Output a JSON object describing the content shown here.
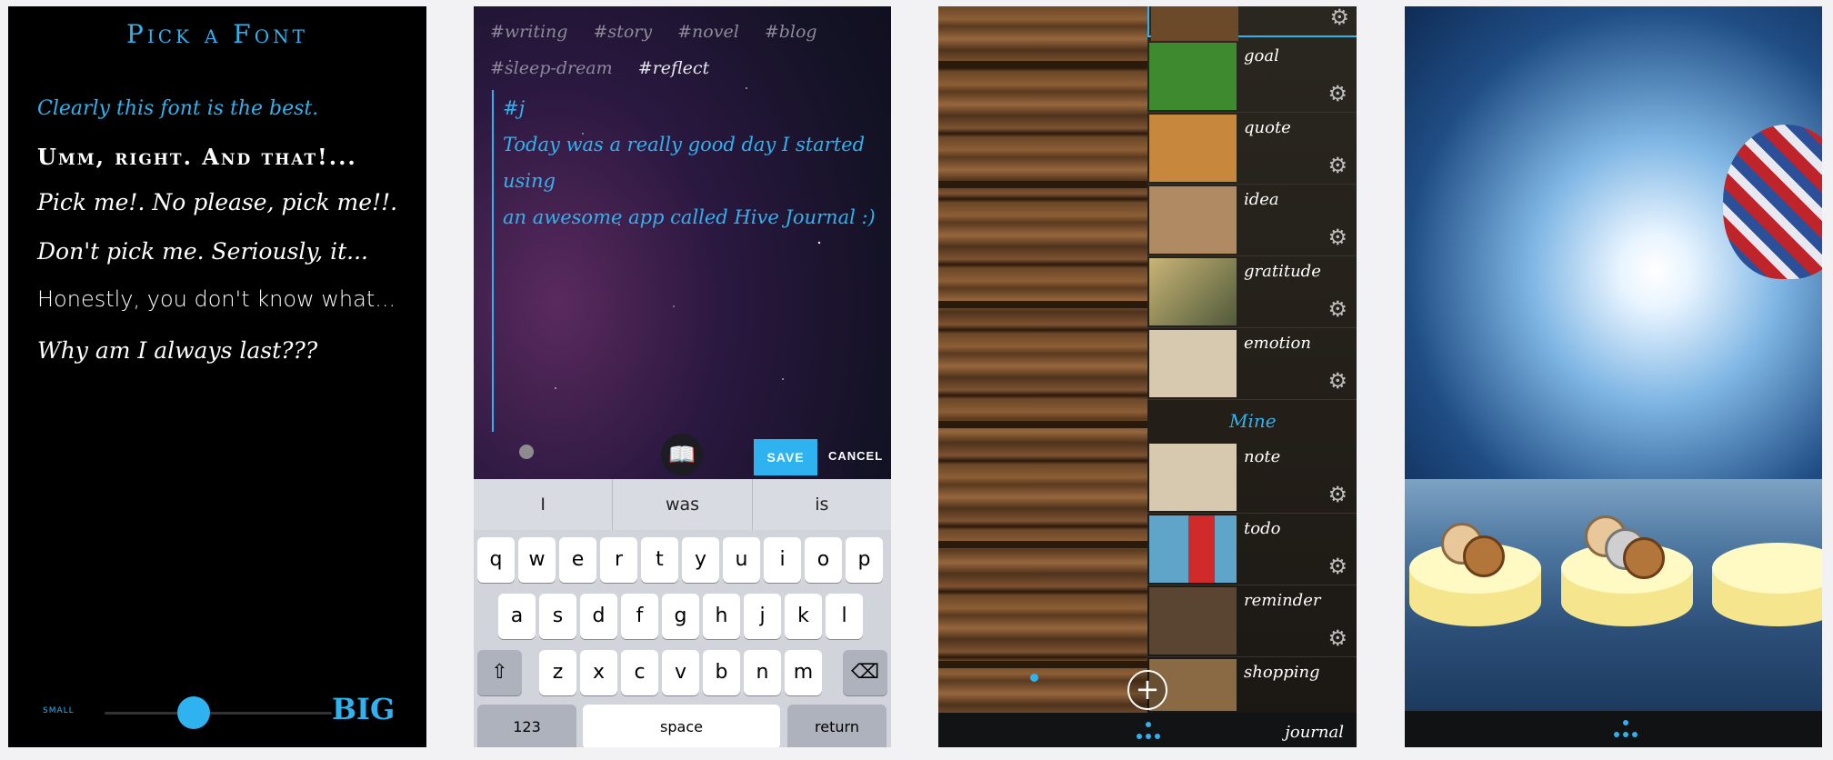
{
  "font_screen": {
    "title": "Pick a Font",
    "samples": [
      "Clearly this font is the best.",
      "Umm, right. And that!...",
      "Pick me!. No please, pick me!!.",
      "Don't pick me. Seriously, it...",
      "Honestly, you don't know what...",
      "Why am I always last???"
    ],
    "slider": {
      "small_label": "small",
      "big_label": "BIG",
      "value_fraction": 0.3
    }
  },
  "editor_screen": {
    "tags": [
      "#writing",
      "#story",
      "#novel",
      "#blog",
      "#sleep-dream",
      "#reflect"
    ],
    "text_line1": "#j",
    "text_line2": "Today was a really good day I started using",
    "text_line3": "an awesome app called Hive Journal :)",
    "save_label": "SAVE",
    "cancel_label": "CANCEL",
    "suggestions": [
      "I",
      "was",
      "is"
    ],
    "keyboard": {
      "row1": [
        "q",
        "w",
        "e",
        "r",
        "t",
        "y",
        "u",
        "i",
        "o",
        "p"
      ],
      "row2": [
        "a",
        "s",
        "d",
        "f",
        "g",
        "h",
        "j",
        "k",
        "l"
      ],
      "row3": [
        "z",
        "x",
        "c",
        "v",
        "b",
        "n",
        "m"
      ],
      "numbers_label": "123",
      "space_label": "space",
      "return_label": "return"
    }
  },
  "journal_list_screen": {
    "items": [
      {
        "label": "goal",
        "thumb_color": "#3e8a2f"
      },
      {
        "label": "quote",
        "thumb_color": "#6b4a2a"
      },
      {
        "label": "idea",
        "thumb_color": "#b08a62"
      },
      {
        "label": "gratitude",
        "thumb_color": "#8a7a55"
      },
      {
        "label": "emotion",
        "thumb_color": "#d6c9b0"
      }
    ],
    "section_label": "Mine",
    "mine_items": [
      {
        "label": "note",
        "thumb_color": "#d6c9b0"
      },
      {
        "label": "todo",
        "thumb_color": "#5fa4c9"
      },
      {
        "label": "reminder",
        "thumb_color": "#5a4432"
      },
      {
        "label": "shopping",
        "thumb_color": "#8a6a45"
      }
    ],
    "footer_label": "journal"
  },
  "scene_screen": {}
}
